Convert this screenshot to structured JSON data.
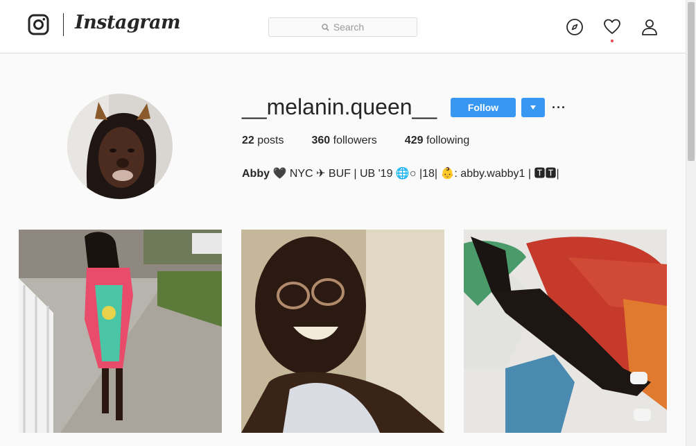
{
  "header": {
    "wordmark": "Instagram",
    "search_placeholder": "Search",
    "icons": [
      "instagram-glyph-icon",
      "search-icon",
      "compass-icon",
      "heart-icon",
      "person-icon"
    ],
    "notification_dot_color": "#ed4956"
  },
  "profile": {
    "username": "__melanin.queen__",
    "follow_label": "Follow",
    "more_label": "···",
    "accent_color": "#3897f0",
    "stats": {
      "posts_count": "22",
      "posts_label": "posts",
      "followers_count": "360",
      "followers_label": "followers",
      "following_count": "429",
      "following_label": "following"
    },
    "bio": {
      "name": "Abby",
      "text": " 🖤 NYC ✈ BUF | UB '19 🌐○ |18| 👶: abby.wabby1 | 🆃🆃|"
    }
  },
  "posts": [
    {
      "icon": "photo-street-icon"
    },
    {
      "icon": "photo-selfie-icon"
    },
    {
      "icon": "photo-mural-icon"
    }
  ]
}
